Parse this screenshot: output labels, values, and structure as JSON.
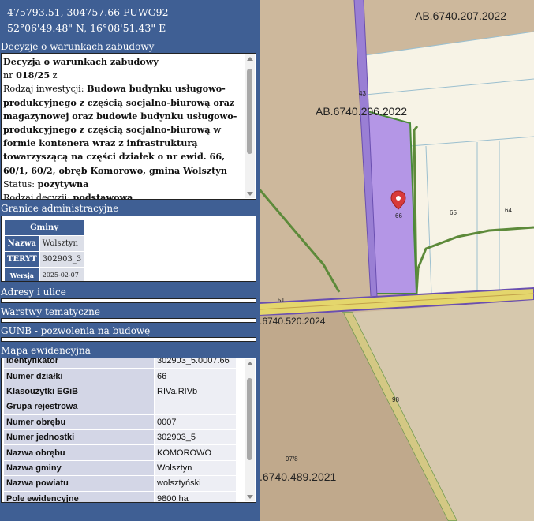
{
  "coords": {
    "line1": "475793.51, 304757.66 PUWG92",
    "line2": "52°06'49.48\" N, 16°08'51.43\" E"
  },
  "decyzje": {
    "title": "Decyzje o warunkach zabudowy",
    "heading": "Decyzja o warunkach zabudowy",
    "nr_prefix": "nr ",
    "nr_value": "018/25",
    "nr_suffix": " z",
    "rodzaj_label": "Rodzaj inwestycji: ",
    "rodzaj_value": "Budowa budynku usługowo-produkcyjnego z częścią socjalno-biurową oraz magazynowej oraz budowie budynku usługowo-produkcyjnego z częścią socjalno-biurową w formie kontenera wraz z infrastrukturą towarzyszącą na części działek o nr ewid. 66, 60/1, 60/2, obręb Komorowo, gmina Wolsztyn",
    "status_label": "Status: ",
    "status_value": "pozytywna",
    "decyzja_label": "Rodzaj decyzji: ",
    "decyzja_value": "podstawowa"
  },
  "granice": {
    "title": "Granice administracyjne",
    "header": "Gminy",
    "rows": [
      {
        "key": "Nazwa",
        "value": "Wolsztyn"
      },
      {
        "key": "TERYT",
        "value": "302903_3"
      },
      {
        "key": "Wersja",
        "value": "2025-02-07"
      }
    ]
  },
  "sections": {
    "adresy": "Adresy i ulice",
    "warstwy": "Warstwy tematyczne",
    "gunb": "GUNB - pozwolenia na budowę",
    "mapa": "Mapa ewidencyjna"
  },
  "ewidencja": {
    "rows": [
      {
        "key": "Identyfikator",
        "value": "302903_5.0007.66"
      },
      {
        "key": "Numer działki",
        "value": "66"
      },
      {
        "key": "Klasoużytki EGiB",
        "value": "RIVa,RIVb"
      },
      {
        "key": "Grupa rejestrowa",
        "value": ""
      },
      {
        "key": "Numer obrębu",
        "value": "0007"
      },
      {
        "key": "Numer jednostki",
        "value": "302903_5"
      },
      {
        "key": "Nazwa obrębu",
        "value": "KOMOROWO"
      },
      {
        "key": "Nazwa gminy",
        "value": "Wolsztyn"
      },
      {
        "key": "Nazwa powiatu",
        "value": "wolsztyński"
      },
      {
        "key": "Pole ewidencyjne",
        "value": "9800 ha"
      }
    ]
  },
  "map": {
    "labels": {
      "ab207": "AB.6740.207.2022",
      "ab206": "AB.6740.206.2022",
      "ab520": ".6740.520.2024",
      "ab489": ".6740.489.2021",
      "p66": "66",
      "p65": "65",
      "p64": "64",
      "p43": "43",
      "p98": "98",
      "p978": "97/8",
      "p51": "51"
    }
  },
  "colors": {
    "panel": "#3f5f94",
    "parcel_highlight": "#b496e6",
    "road": "#e4d66c",
    "marker": "#d83a3a"
  }
}
